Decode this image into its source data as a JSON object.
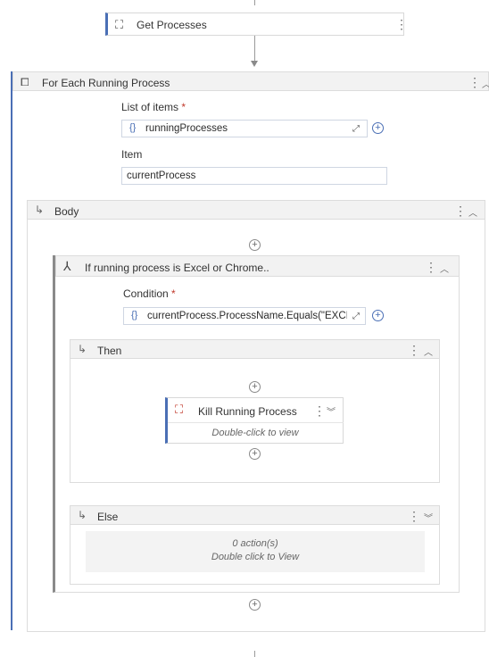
{
  "get_processes": {
    "title": "Get Processes",
    "icon": "process-gear-icon"
  },
  "for_each": {
    "title": "For Each Running Process",
    "list_label": "List of items",
    "list_required": "*",
    "list_value": "runningProcesses",
    "item_label": "Item",
    "item_value": "currentProcess"
  },
  "body": {
    "title": "Body"
  },
  "if_block": {
    "title": "If running process is Excel or Chrome..",
    "condition_label": "Condition",
    "condition_required": "*",
    "condition_value": "currentProcess.ProcessName.Equals(\"EXCI"
  },
  "then": {
    "title": "Then",
    "kill": {
      "title": "Kill Running Process",
      "subtitle": "Double-click to view"
    }
  },
  "else": {
    "title": "Else",
    "empty_count": "0 action(s)",
    "empty_hint": "Double click to View"
  },
  "colors": {
    "accent": "#4a6fb5",
    "kill_red": "#c0392b",
    "header_bg": "#f2f2f2"
  }
}
